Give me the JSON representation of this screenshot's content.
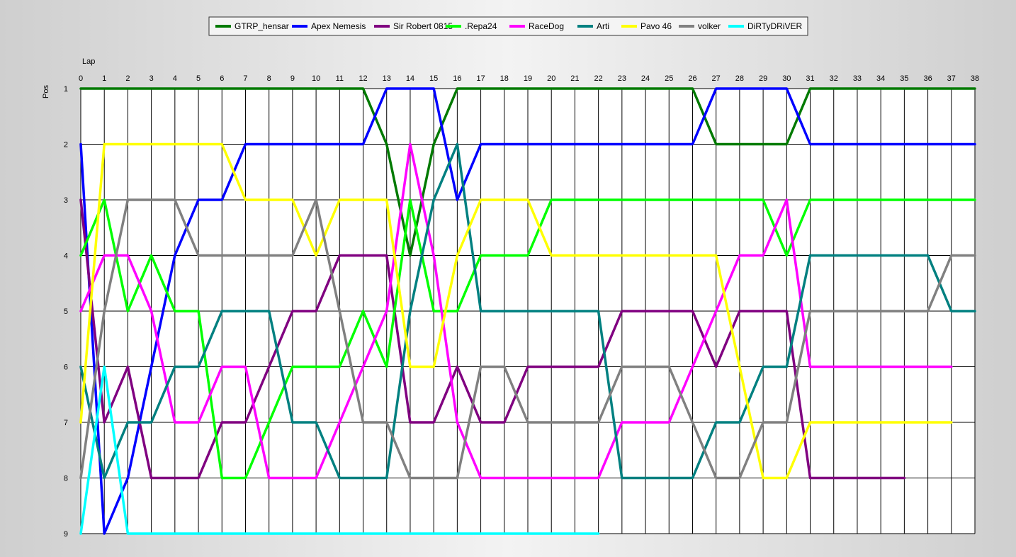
{
  "chart_data": {
    "type": "line",
    "xlabel": "Lap",
    "ylabel": "Pos",
    "xlim": [
      0,
      38
    ],
    "ylim": [
      1,
      9
    ],
    "y_inverted": true,
    "grid": true,
    "legend_position": "top",
    "x_ticks": [
      0,
      1,
      2,
      3,
      4,
      5,
      6,
      7,
      8,
      9,
      10,
      11,
      12,
      13,
      14,
      15,
      16,
      17,
      18,
      19,
      20,
      21,
      22,
      23,
      24,
      25,
      26,
      27,
      28,
      29,
      30,
      31,
      32,
      33,
      34,
      35,
      36,
      37,
      38
    ],
    "y_ticks": [
      1,
      2,
      3,
      4,
      5,
      6,
      7,
      8,
      9
    ],
    "series": [
      {
        "name": "GTRP_hensar",
        "color": "#007a00",
        "values": [
          1,
          1,
          1,
          1,
          1,
          1,
          1,
          1,
          1,
          1,
          1,
          1,
          1,
          2,
          4,
          2,
          1,
          1,
          1,
          1,
          1,
          1,
          1,
          1,
          1,
          1,
          1,
          2,
          2,
          2,
          2,
          1,
          1,
          1,
          1,
          1,
          1,
          1,
          1
        ]
      },
      {
        "name": "Apex Nemesis",
        "color": "#0000ff",
        "values": [
          2,
          9,
          8,
          6,
          4,
          3,
          3,
          2,
          2,
          2,
          2,
          2,
          2,
          1,
          1,
          1,
          3,
          2,
          2,
          2,
          2,
          2,
          2,
          2,
          2,
          2,
          2,
          1,
          1,
          1,
          1,
          2,
          2,
          2,
          2,
          2,
          2,
          2,
          2
        ]
      },
      {
        "name": "Sir Robert 0815",
        "color": "#800080",
        "values": [
          3,
          7,
          6,
          8,
          8,
          8,
          7,
          7,
          6,
          5,
          5,
          4,
          4,
          4,
          7,
          7,
          6,
          7,
          7,
          6,
          6,
          6,
          6,
          5,
          5,
          5,
          5,
          6,
          5,
          5,
          5,
          8,
          8,
          8,
          8,
          8
        ]
      },
      {
        "name": ".Repa24",
        "color": "#00ff00",
        "values": [
          4,
          3,
          5,
          4,
          5,
          5,
          8,
          8,
          7,
          6,
          6,
          6,
          5,
          6,
          3,
          5,
          5,
          4,
          4,
          4,
          3,
          3,
          3,
          3,
          3,
          3,
          3,
          3,
          3,
          3,
          4,
          3,
          3,
          3,
          3,
          3,
          3,
          3,
          3
        ]
      },
      {
        "name": "RaceDog",
        "color": "#ff00ff",
        "values": [
          5,
          4,
          4,
          5,
          7,
          7,
          6,
          6,
          8,
          8,
          8,
          7,
          6,
          5,
          2,
          4,
          7,
          8,
          8,
          8,
          8,
          8,
          8,
          7,
          7,
          7,
          6,
          5,
          4,
          4,
          3,
          6,
          6,
          6,
          6,
          6,
          6,
          6
        ]
      },
      {
        "name": "Arti",
        "color": "#008080",
        "values": [
          6,
          8,
          7,
          7,
          6,
          6,
          5,
          5,
          5,
          7,
          7,
          8,
          8,
          8,
          5,
          3,
          2,
          5,
          5,
          5,
          5,
          5,
          5,
          8,
          8,
          8,
          8,
          7,
          7,
          6,
          6,
          4,
          4,
          4,
          4,
          4,
          4,
          5,
          5
        ]
      },
      {
        "name": "Pavo 46",
        "color": "#ffff00",
        "values": [
          7,
          2,
          2,
          2,
          2,
          2,
          2,
          3,
          3,
          3,
          4,
          3,
          3,
          3,
          6,
          6,
          4,
          3,
          3,
          3,
          4,
          4,
          4,
          4,
          4,
          4,
          4,
          4,
          6,
          8,
          8,
          7,
          7,
          7,
          7,
          7,
          7,
          7
        ]
      },
      {
        "name": "volker",
        "color": "#808080",
        "values": [
          8,
          5,
          3,
          3,
          3,
          4,
          4,
          4,
          4,
          4,
          3,
          5,
          7,
          7,
          8,
          8,
          8,
          6,
          6,
          7,
          7,
          7,
          7,
          6,
          6,
          6,
          7,
          8,
          8,
          7,
          7,
          5,
          5,
          5,
          5,
          5,
          5,
          4,
          4
        ]
      },
      {
        "name": "DiRTyDRiVER",
        "color": "#00ffff",
        "values": [
          9,
          6,
          9,
          9,
          9,
          9,
          9,
          9,
          9,
          9,
          9,
          9,
          9,
          9,
          9,
          9,
          9,
          9,
          9,
          9,
          9,
          9,
          9
        ]
      }
    ]
  }
}
